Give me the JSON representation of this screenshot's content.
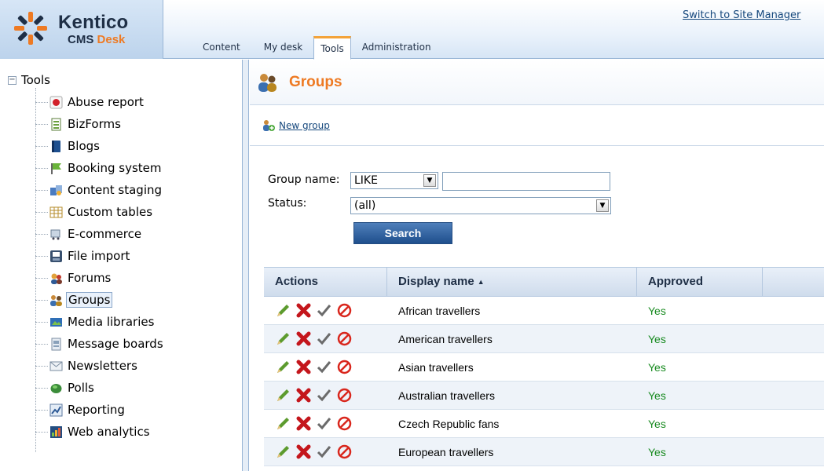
{
  "app": {
    "logo_brand": "Kentico",
    "logo_product_prefix": "CMS",
    "logo_product_accent": "Desk",
    "switch_link": "Switch to Site Manager",
    "accent_color": "#ee7a23"
  },
  "tabs": [
    {
      "label": "Content",
      "active": false
    },
    {
      "label": "My desk",
      "active": false
    },
    {
      "label": "Tools",
      "active": true
    },
    {
      "label": "Administration",
      "active": false
    }
  ],
  "tree": {
    "root_label": "Tools",
    "expander": "−",
    "items": [
      {
        "label": "Abuse report",
        "icon": "abuse-report-icon",
        "selected": false
      },
      {
        "label": "BizForms",
        "icon": "bizforms-icon",
        "selected": false
      },
      {
        "label": "Blogs",
        "icon": "blogs-icon",
        "selected": false
      },
      {
        "label": "Booking system",
        "icon": "booking-system-icon",
        "selected": false
      },
      {
        "label": "Content staging",
        "icon": "content-staging-icon",
        "selected": false
      },
      {
        "label": "Custom tables",
        "icon": "custom-tables-icon",
        "selected": false
      },
      {
        "label": "E-commerce",
        "icon": "ecommerce-icon",
        "selected": false
      },
      {
        "label": "File import",
        "icon": "file-import-icon",
        "selected": false
      },
      {
        "label": "Forums",
        "icon": "forums-icon",
        "selected": false
      },
      {
        "label": "Groups",
        "icon": "groups-icon",
        "selected": true
      },
      {
        "label": "Media libraries",
        "icon": "media-libraries-icon",
        "selected": false
      },
      {
        "label": "Message boards",
        "icon": "message-boards-icon",
        "selected": false
      },
      {
        "label": "Newsletters",
        "icon": "newsletters-icon",
        "selected": false
      },
      {
        "label": "Polls",
        "icon": "polls-icon",
        "selected": false
      },
      {
        "label": "Reporting",
        "icon": "reporting-icon",
        "selected": false
      },
      {
        "label": "Web analytics",
        "icon": "web-analytics-icon",
        "selected": false
      }
    ]
  },
  "page": {
    "title": "Groups",
    "new_group_label": "New group"
  },
  "filter": {
    "group_name_label": "Group name:",
    "operator_value": "LIKE",
    "name_value": "",
    "status_label": "Status:",
    "status_value": "(all)",
    "search_button": "Search"
  },
  "grid": {
    "headers": {
      "actions": "Actions",
      "display_name": "Display name",
      "approved": "Approved"
    },
    "rows": [
      {
        "display_name": "African travellers",
        "approved": "Yes"
      },
      {
        "display_name": "American travellers",
        "approved": "Yes"
      },
      {
        "display_name": "Asian travellers",
        "approved": "Yes"
      },
      {
        "display_name": "Australian travellers",
        "approved": "Yes"
      },
      {
        "display_name": "Czech Republic fans",
        "approved": "Yes"
      },
      {
        "display_name": "European travellers",
        "approved": "Yes"
      }
    ]
  }
}
